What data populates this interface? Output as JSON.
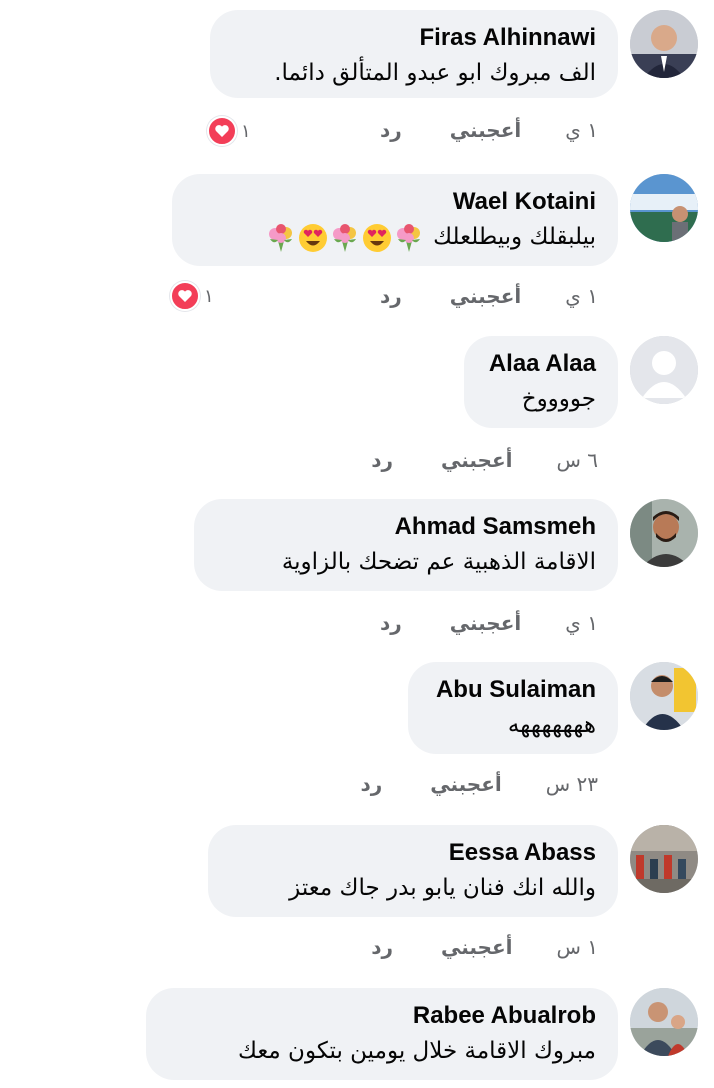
{
  "colors": {
    "bubble_bg": "#f0f2f5",
    "text": "#050505",
    "meta": "#65676b",
    "heart": "#f33e58"
  },
  "actions": {
    "like_label": "أعجبني",
    "reply_label": "رد"
  },
  "comments": [
    {
      "author": "Firas Alhinnawi",
      "text": "الف مبروك ابو عبدو المتألق دائما.",
      "time": "١ ي",
      "reaction": {
        "icon": "heart-icon",
        "count": "١"
      }
    },
    {
      "author": "Wael Kotaini",
      "text": "بيلبقلك وبيطلعلك",
      "emojis": [
        "bouquet-emoji",
        "heart-eyes-emoji",
        "bouquet-emoji",
        "heart-eyes-emoji",
        "bouquet-emoji"
      ],
      "time": "١ ي",
      "reaction": {
        "icon": "heart-icon",
        "count": "١"
      }
    },
    {
      "author": "Alaa Alaa",
      "text": "جووووخ",
      "time": "٦ س"
    },
    {
      "author": "Ahmad Samsmeh",
      "text": "الاقامة الذهبية عم تضحك بالزاوية",
      "time": "١ ي"
    },
    {
      "author": "Abu Sulaiman",
      "text": "هههههههه",
      "time": "٢٣ س"
    },
    {
      "author": "Eessa Abass",
      "text": "والله انك فنان يابو بدر جاك معتز",
      "time": "١ س"
    },
    {
      "author": "Rabee Abualrob",
      "text": "مبروك الاقامة خلال يومين بتكون معك"
    }
  ]
}
